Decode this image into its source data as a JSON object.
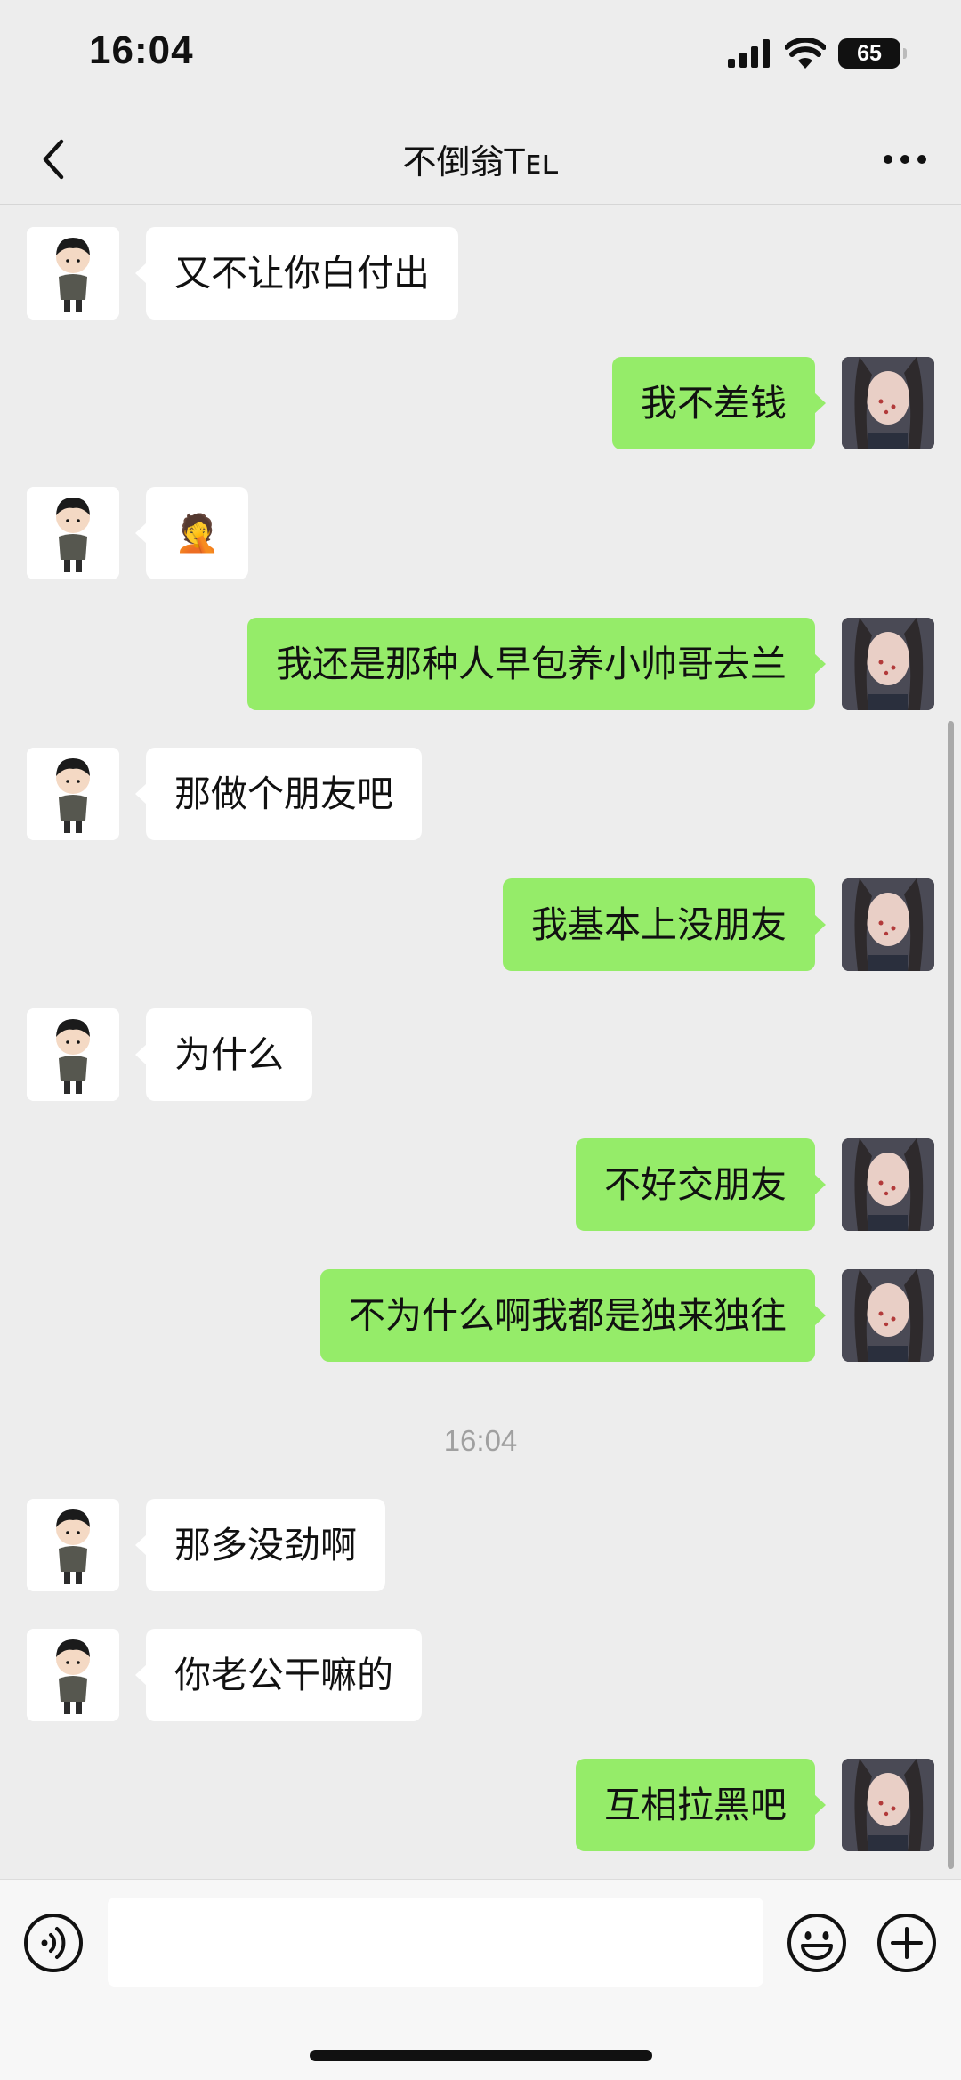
{
  "status_bar": {
    "time": "16:04",
    "battery": "65"
  },
  "nav": {
    "title": "不倒翁Tᴇʟ"
  },
  "messages": [
    {
      "side": "left",
      "text": "又不让你白付出"
    },
    {
      "side": "right",
      "text": "我不差钱"
    },
    {
      "side": "left",
      "text": "🤦"
    },
    {
      "side": "right",
      "text": "我还是那种人早包养小帅哥去兰"
    },
    {
      "side": "left",
      "text": "那做个朋友吧"
    },
    {
      "side": "right",
      "text": "我基本上没朋友"
    },
    {
      "side": "left",
      "text": "为什么"
    },
    {
      "side": "right",
      "text": "不好交朋友"
    },
    {
      "side": "right",
      "text": "不为什么啊我都是独来独往"
    },
    {
      "side": "left",
      "text": "那多没劲啊"
    },
    {
      "side": "left",
      "text": "你老公干嘛的"
    },
    {
      "side": "right",
      "text": "互相拉黑吧"
    }
  ],
  "timestamp": "16:04",
  "colors": {
    "background": "#ededed",
    "sent_bubble": "#95ec69",
    "received_bubble": "#ffffff"
  },
  "icons": [
    "back-chevron-icon",
    "more-dots-icon",
    "signal-icon",
    "wifi-icon",
    "voice-icon",
    "emoji-icon",
    "plus-icon"
  ]
}
